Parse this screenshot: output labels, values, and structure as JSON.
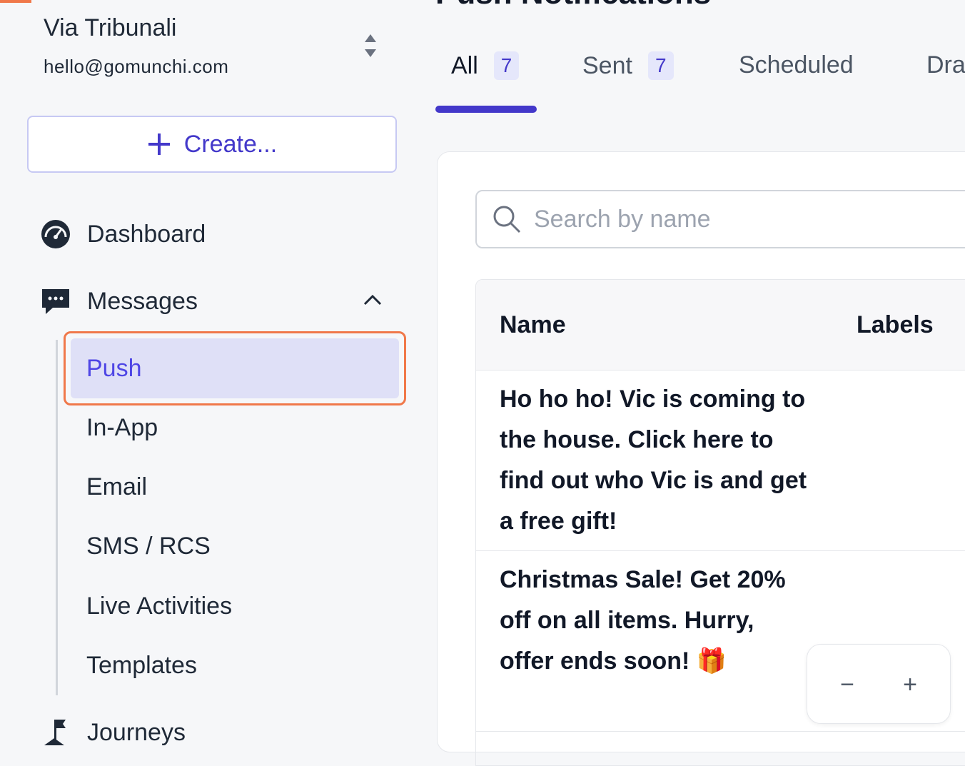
{
  "sidebar": {
    "org_name": "Via Tribunali",
    "org_email": "hello@gomunchi.com",
    "create_label": "Create...",
    "nav": {
      "dashboard": "Dashboard",
      "messages": "Messages",
      "journeys": "Journeys"
    },
    "messages_items": {
      "push": "Push",
      "in_app": "In-App",
      "email": "Email",
      "sms": "SMS / RCS",
      "live": "Live Activities",
      "templates": "Templates"
    }
  },
  "main": {
    "page_title": "Push Notifications",
    "tabs": [
      {
        "label": "All",
        "count": "7"
      },
      {
        "label": "Sent",
        "count": "7"
      },
      {
        "label": "Scheduled"
      },
      {
        "label": "Dra"
      }
    ],
    "search_placeholder": "Search by name",
    "table": {
      "columns": [
        "Name",
        "Labels"
      ],
      "rows": [
        {
          "name": "Ho ho ho! Vic is coming to the house. Click here to find out who Vic is and get a free gift!"
        },
        {
          "name": "Christmas Sale! Get 20% off on all items. Hurry, offer ends soon! 🎁"
        }
      ]
    },
    "zoom": {
      "minus": "−",
      "plus": "+"
    }
  },
  "colors": {
    "accent": "#4338ca",
    "active_bg": "#dfe0f7",
    "focus_outline": "#f0784a"
  }
}
